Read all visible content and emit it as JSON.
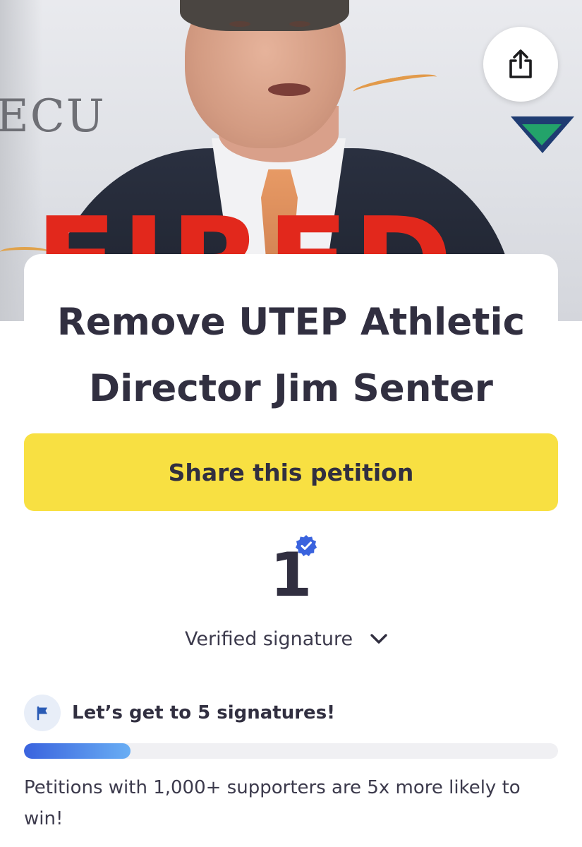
{
  "hero": {
    "banner_logo_text": "ECU",
    "overlay_text": "FIRED",
    "share_icon": "share-up-arrow-icon"
  },
  "petition": {
    "title": "Remove UTEP Athletic Director Jim Senter",
    "share_button_label": "Share this petition"
  },
  "signatures": {
    "count": "1",
    "verified_icon": "verified-badge-icon",
    "label": "Verified signature",
    "dropdown_icon": "chevron-down-icon"
  },
  "goal": {
    "icon": "flag-icon",
    "text": "Let’s get to 5 signatures!",
    "progress_fraction": 0.2,
    "info": "Petitions with 1,000+ supporters are 5x more likely to win!"
  },
  "colors": {
    "share_button_bg": "#f8e042",
    "progress_start": "#3a63de",
    "progress_end": "#69aef4",
    "verified_badge": "#3a63de",
    "text_dark": "#312f40"
  }
}
